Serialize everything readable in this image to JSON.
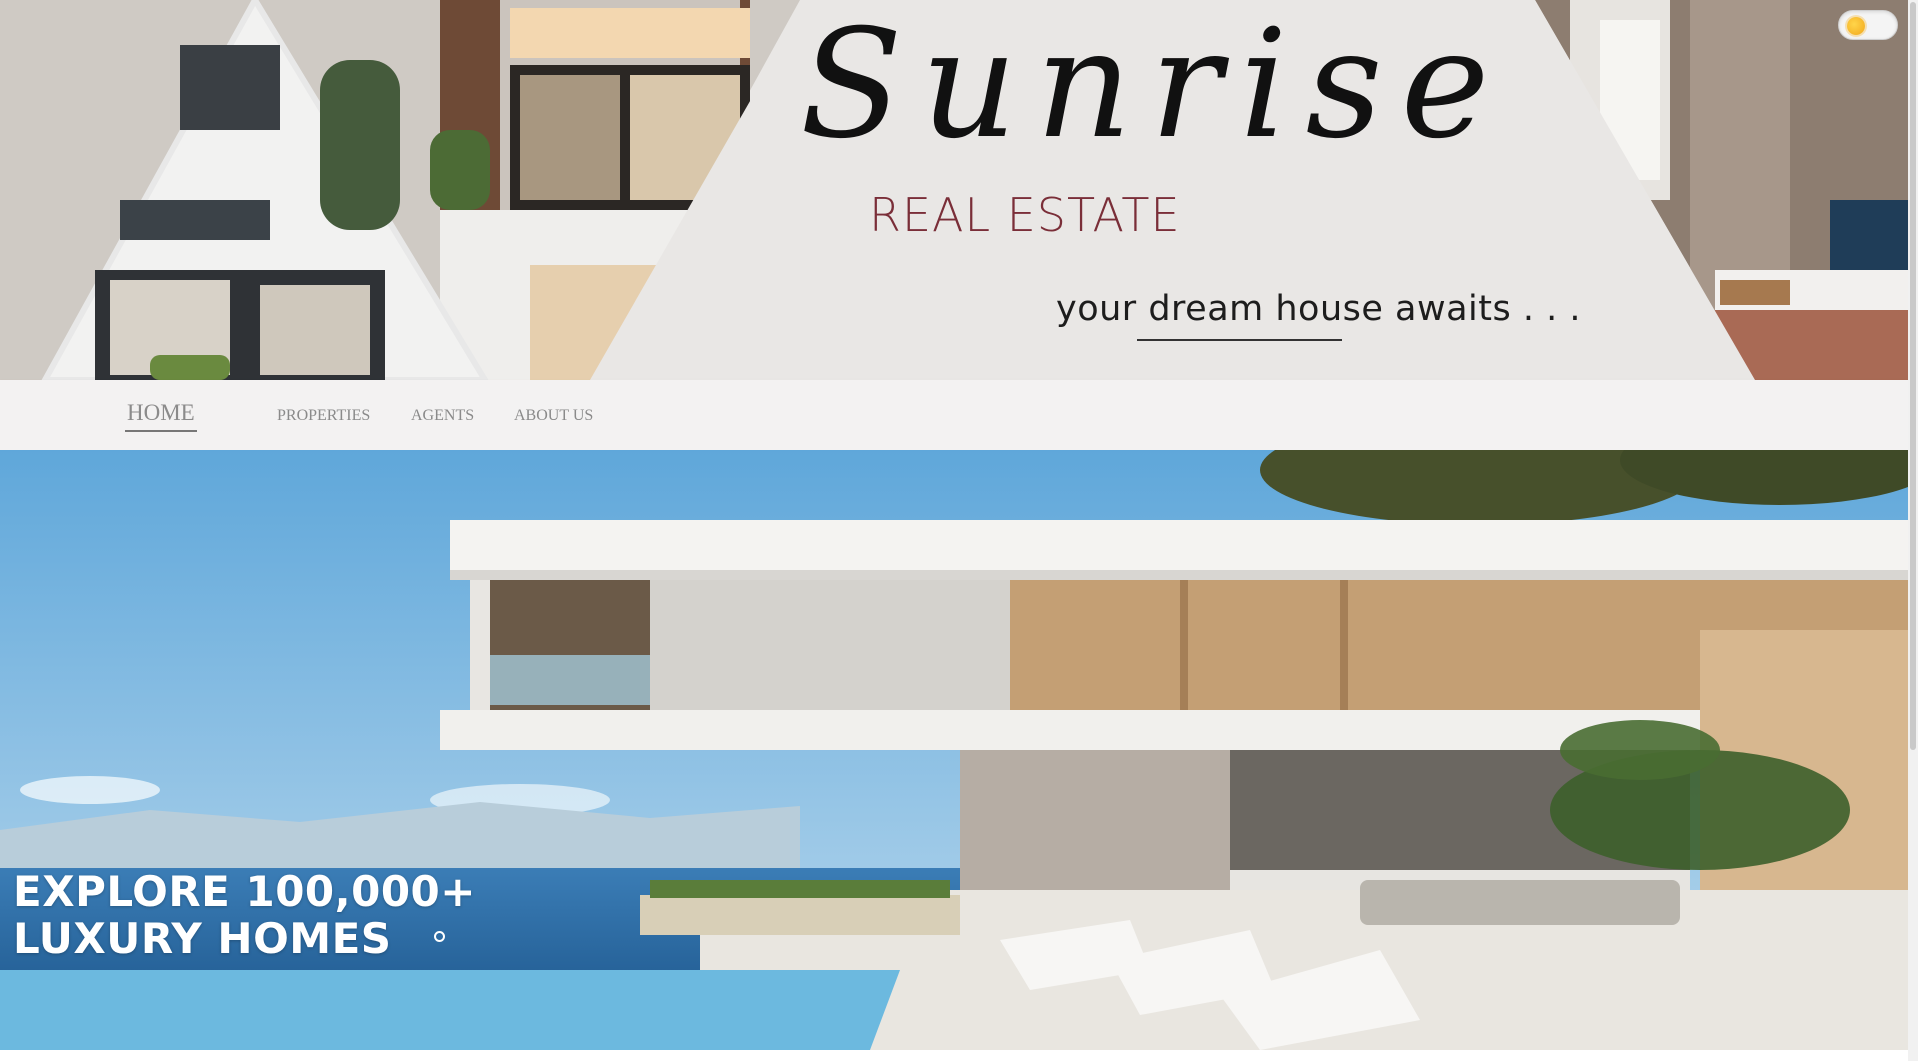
{
  "header": {
    "brand_script": "Sunrise",
    "brand_sub": "REAL ESTATE",
    "tagline": "your dream house awaits . . .",
    "theme_toggle_icon": "sun-icon"
  },
  "nav": {
    "items": [
      {
        "label": "HOME",
        "active": true
      },
      {
        "label": "PROPERTIES",
        "active": false
      },
      {
        "label": "AGENTS",
        "active": false
      },
      {
        "label": "ABOUT US",
        "active": false
      }
    ]
  },
  "hero": {
    "title_line1": "EXPLORE 100,000+",
    "title_line2": "LUXURY HOMES"
  },
  "colors": {
    "banner_bg": "#e9e7e5",
    "brand_sub": "#7a2e38",
    "nav_bg": "#f3f2f2",
    "nav_text": "#8a8a8a",
    "sky": "#6fb1de",
    "sea": "#2a6fa6"
  }
}
